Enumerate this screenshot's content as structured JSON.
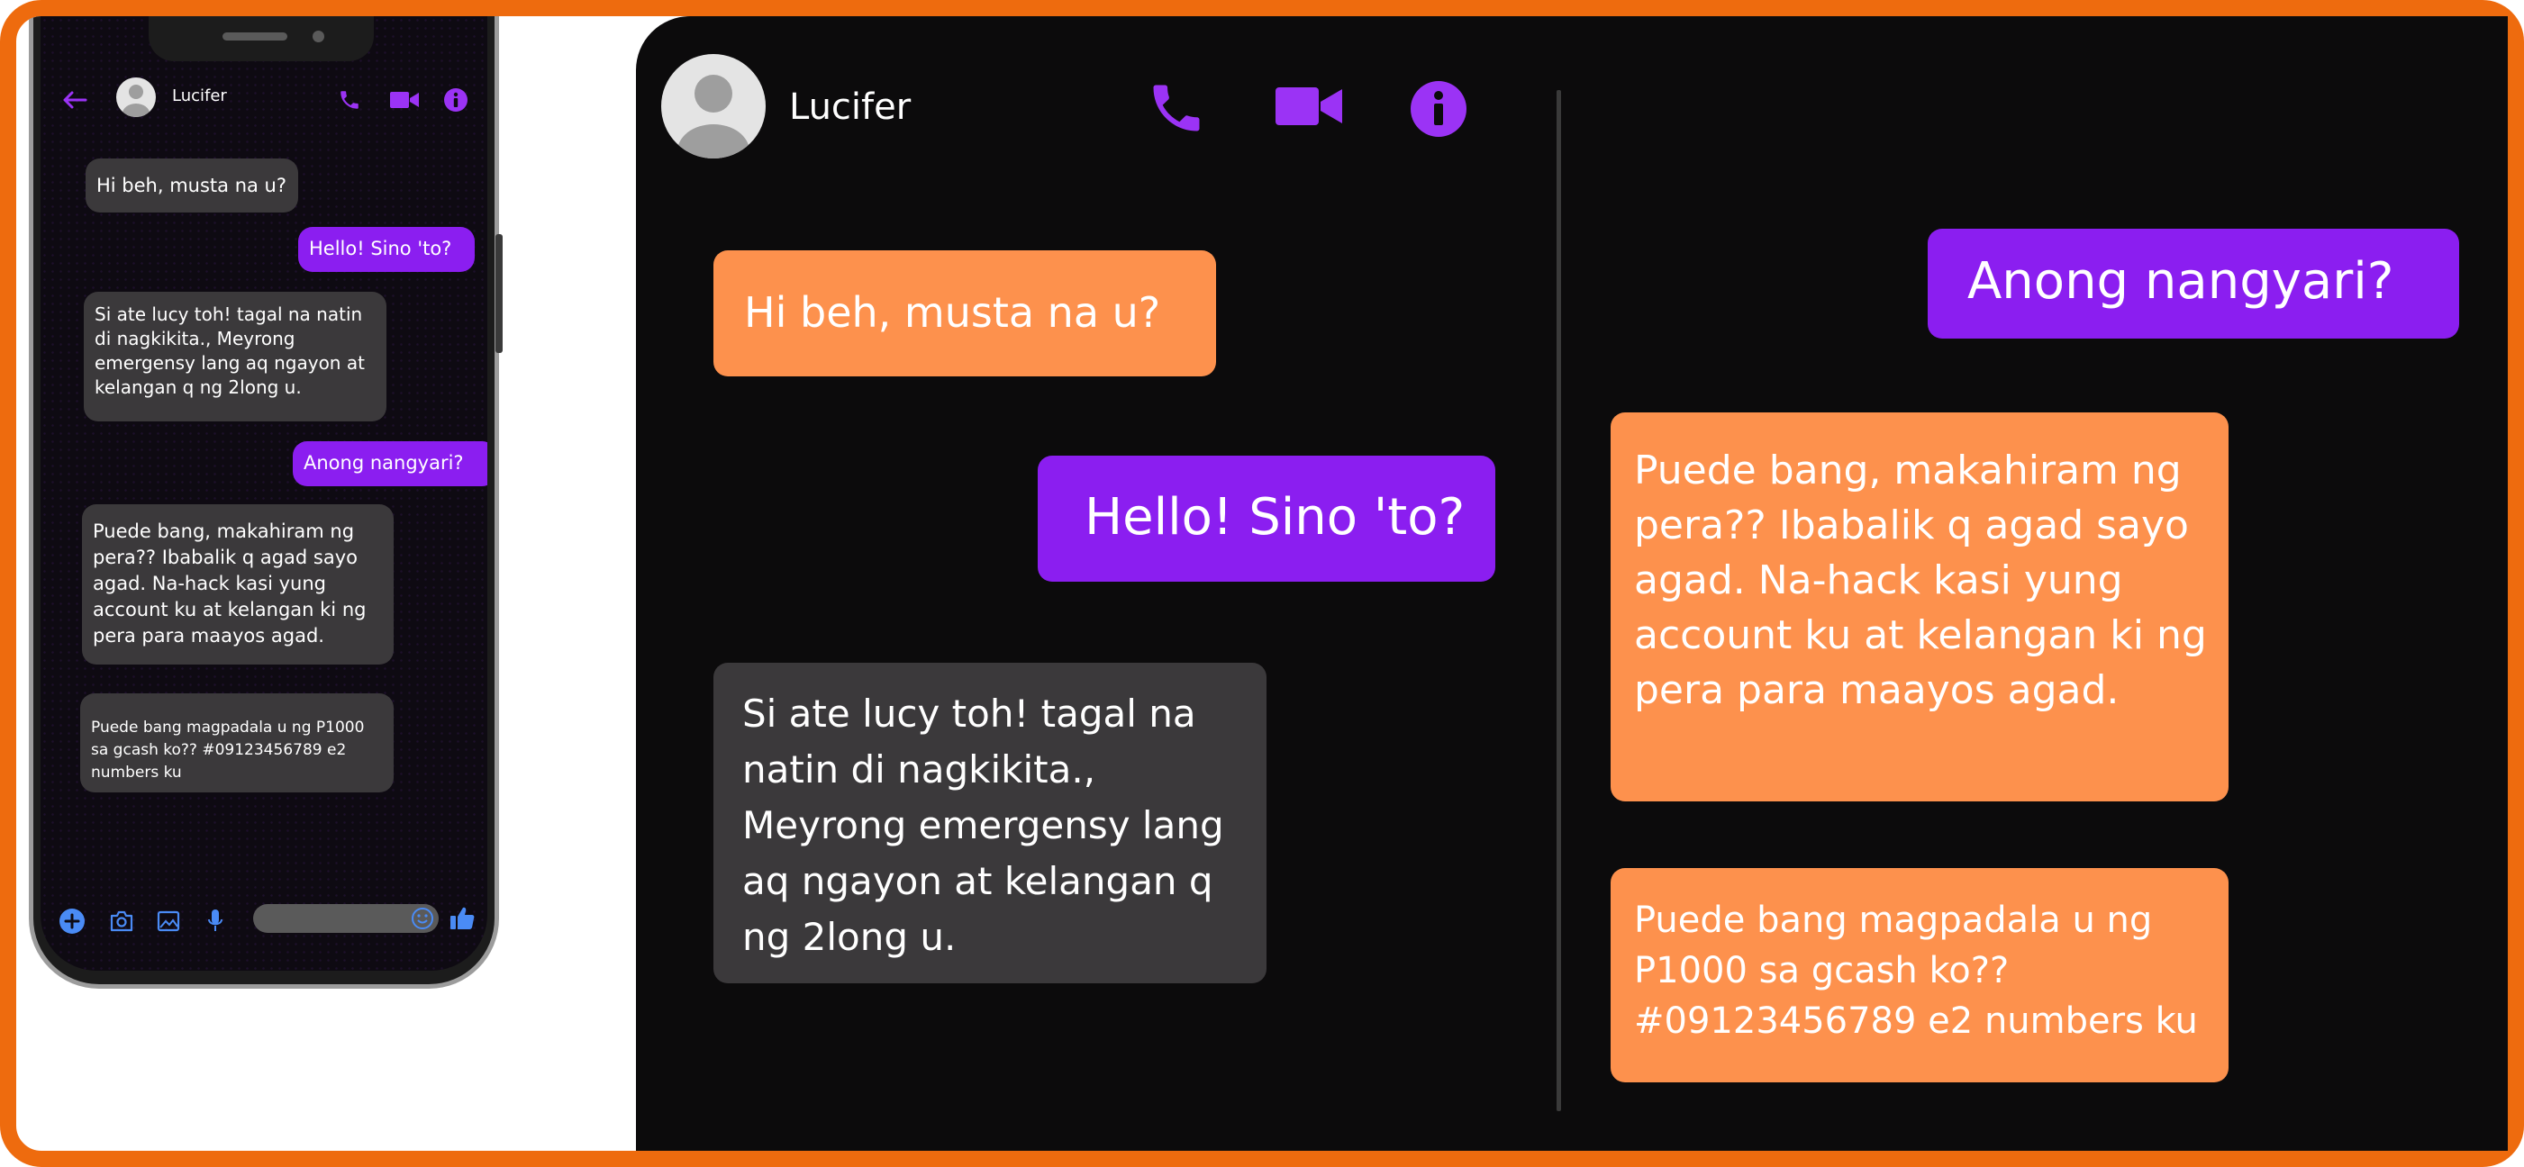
{
  "contact": {
    "name": "Lucifer"
  },
  "messages": [
    {
      "sender": "contact",
      "color": "gray",
      "text": "Hi beh, musta na u?"
    },
    {
      "sender": "me",
      "color": "purple",
      "text": "Hello! Sino 'to?"
    },
    {
      "sender": "contact",
      "color": "gray",
      "text": "Si ate lucy toh! tagal na natin di nagkikita., Meyrong emergensy lang aq ngayon at kelangan q ng 2long u."
    },
    {
      "sender": "me",
      "color": "purple",
      "text": "Anong nangyari?"
    },
    {
      "sender": "contact",
      "color": "orange",
      "text": "Puede bang, makahiram ng pera?? Ibabalik q agad sayo agad. Na-hack kasi yung account ku at kelangan ki ng pera para maayos agad."
    },
    {
      "sender": "contact",
      "color": "orange",
      "text": "Puede bang magpadala u ng P1000 sa gcash ko?? #09123456789 e2 numbers ku"
    }
  ],
  "icons": {
    "back": "arrow-left-icon",
    "call": "phone-icon",
    "video": "video-camera-icon",
    "info": "info-icon",
    "add": "plus-circle-icon",
    "camera": "camera-icon",
    "gallery": "image-icon",
    "mic": "microphone-icon",
    "emoji": "smiley-icon",
    "like": "thumbs-up-icon"
  },
  "colors": {
    "frame_border": "#ee6b0e",
    "panel_background": "#0c0b0c",
    "accent_purple": "#8b1ef0",
    "bubble_orange": "#fd914d",
    "bubble_gray": "#3b393b",
    "like_blue": "#4a8bf5"
  }
}
